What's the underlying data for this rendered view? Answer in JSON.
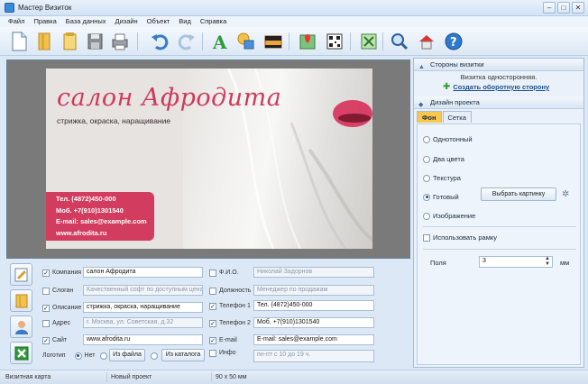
{
  "window": {
    "title": "Мастер Визиток",
    "controls": [
      "–",
      "□",
      "✕"
    ]
  },
  "menu": [
    "Файл",
    "Правка",
    "База данных",
    "Дизайн",
    "Объект",
    "Вид",
    "Справка"
  ],
  "toolbar": {
    "icons": [
      "new-document-icon",
      "open-folder-icon",
      "templates-icon",
      "save-icon",
      "print-icon",
      "undo-icon",
      "redo-icon",
      "text-icon",
      "shapes-icon",
      "image-icon",
      "map-icon",
      "qr-code-icon",
      "fit-icon",
      "zoom-icon",
      "home-icon",
      "help-icon"
    ]
  },
  "card": {
    "company": "салон Афродита",
    "tagline": "стрижка, окраска, наращивание",
    "contact": [
      "Тел. (4872)450-000",
      "Моб. +7(910)1301540",
      "E-mail: sales@example.com",
      "www.afrodita.ru"
    ],
    "accent": "#d23c5e"
  },
  "form": {
    "company": {
      "label": "Компания",
      "checked": true,
      "value": "салон Афродита"
    },
    "slogan": {
      "label": "Слоган",
      "checked": false,
      "value": "Качественный софт по доступным ценам"
    },
    "description": {
      "label": "Описание",
      "checked": true,
      "value": "стрижка, окраска, наращивание"
    },
    "address": {
      "label": "Адрес",
      "checked": false,
      "value": "г. Москва, ул. Советская, д.32"
    },
    "site": {
      "label": "Сайт",
      "checked": true,
      "value": "www.afrodita.ru"
    },
    "logo": {
      "label": "Логотип",
      "options": [
        "Нет",
        "Из файла",
        "Из каталога"
      ],
      "selected": "Нет"
    },
    "fio": {
      "label": "Ф.И.О.",
      "checked": false,
      "value": "Николай Задорнов"
    },
    "position": {
      "label": "Должность",
      "checked": false,
      "value": "Менеджер по продажам"
    },
    "phone1": {
      "label": "Телефон 1",
      "checked": true,
      "value": "Тел. (4872)450-000"
    },
    "phone2": {
      "label": "Телефон 2",
      "checked": true,
      "value": "Моб. +7(910)1301540"
    },
    "email": {
      "label": "E-mail",
      "checked": true,
      "value": "E-mail: sales@example.com"
    },
    "info": {
      "label": "Инфо",
      "checked": false,
      "value": "пн-пт с 10 до 19 ч."
    }
  },
  "right_panel": {
    "sides_header": "Стороны визитки",
    "sides_info": "Визитка односторонняя.",
    "sides_link": "Создать оборотную сторону",
    "design_header": "Дизайн проекта",
    "tabs": [
      "Фон",
      "Сетка"
    ],
    "active_tab": "Фон",
    "options": [
      "Однотонный",
      "Два цвета",
      "Текстура",
      "Готовый",
      "Изображение"
    ],
    "selected_option": "Готовый",
    "choose_picture": "Выбрать картинку",
    "use_frame": "Использовать рамку",
    "margins_label": "Поля",
    "margins_value": "3",
    "margins_unit": "мм"
  },
  "status": [
    "Визитная карта",
    "Новый проект",
    "90 x 50 мм"
  ]
}
